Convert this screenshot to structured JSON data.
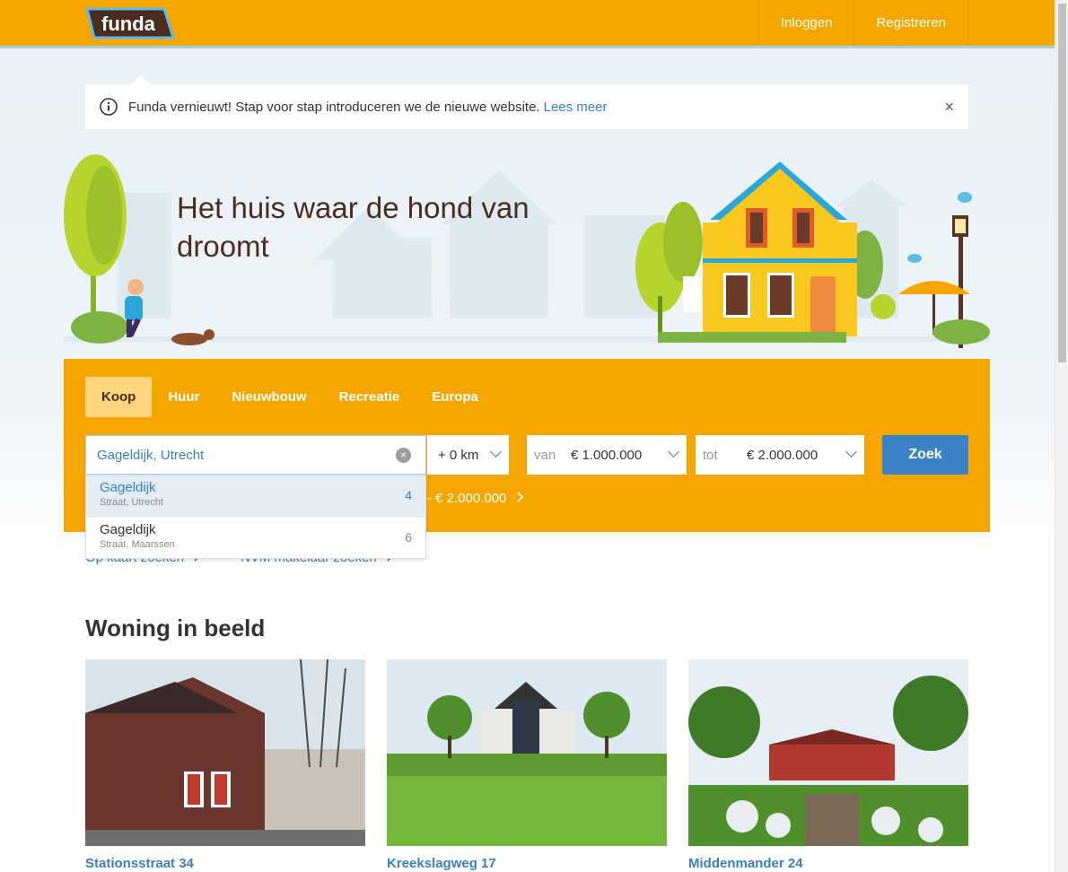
{
  "header": {
    "logo_text": "funda",
    "login": "Inloggen",
    "register": "Registreren"
  },
  "notice": {
    "text": "Funda vernieuwt! Stap voor stap introduceren we de nieuwe website.",
    "link": "Lees meer",
    "close": "×"
  },
  "hero": {
    "title": "Het huis waar de hond van droomt"
  },
  "search": {
    "tabs": [
      {
        "label": "Koop",
        "active": true
      },
      {
        "label": "Huur"
      },
      {
        "label": "Nieuwbouw"
      },
      {
        "label": "Recreatie"
      },
      {
        "label": "Europa"
      }
    ],
    "query": "Gageldijk, Utrecht",
    "radius": "+ 0 km",
    "price_from_label": "van",
    "price_from": "€ 1.000.000",
    "price_to_label": "tot",
    "price_to": "€ 2.000.000",
    "submit": "Zoek",
    "recent_search": "- € 2.000.000"
  },
  "suggestions": [
    {
      "name": "Gageldijk",
      "sub": "Straat, Utrecht",
      "count": "4"
    },
    {
      "name": "Gageldijk",
      "sub": "Straat, Maarssen",
      "count": "6"
    }
  ],
  "links": {
    "map": "Op kaart zoeken",
    "agent": "NVM makelaar zoeken"
  },
  "section": {
    "title": "Woning in beeld"
  },
  "cards": [
    {
      "title": "Stationsstraat 34"
    },
    {
      "title": "Kreekslagweg 17"
    },
    {
      "title": "Middenmander 24"
    }
  ],
  "colors": {
    "brand_orange": "#f7a600",
    "link_blue": "#3b7fb9",
    "button_blue": "#3a83c6"
  }
}
